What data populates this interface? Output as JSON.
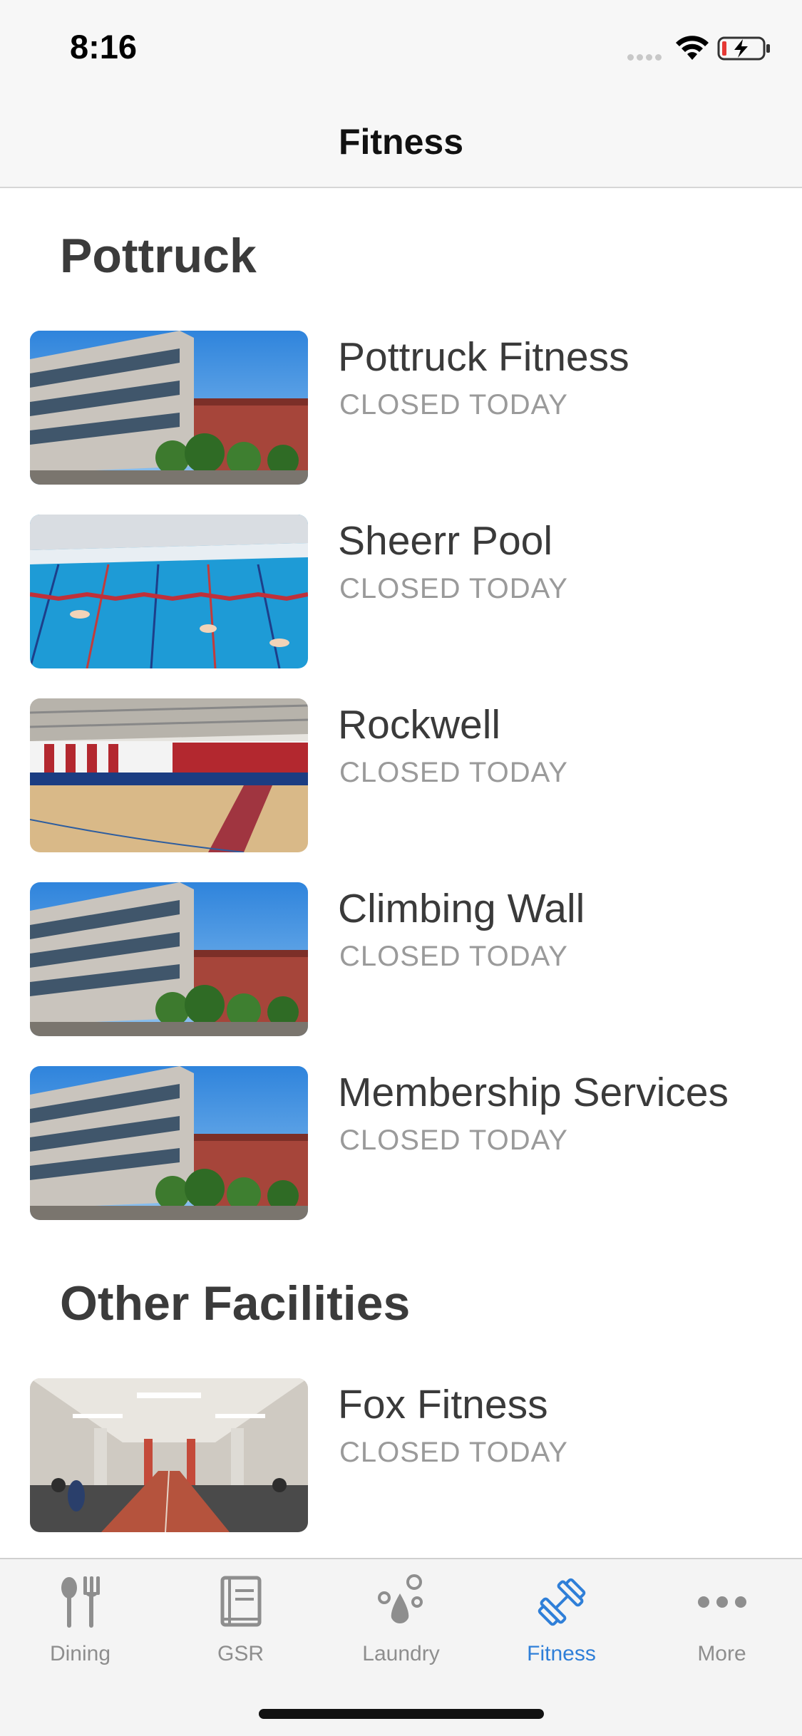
{
  "status_bar": {
    "time": "8:16"
  },
  "nav": {
    "title": "Fitness"
  },
  "sections": [
    {
      "title": "Pottruck",
      "items": [
        {
          "name": "Pottruck Fitness",
          "status": "CLOSED TODAY",
          "image": "building"
        },
        {
          "name": "Sheerr Pool",
          "status": "CLOSED TODAY",
          "image": "pool"
        },
        {
          "name": "Rockwell",
          "status": "CLOSED TODAY",
          "image": "gym"
        },
        {
          "name": "Climbing Wall",
          "status": "CLOSED TODAY",
          "image": "building"
        },
        {
          "name": "Membership Services",
          "status": "CLOSED TODAY",
          "image": "building"
        }
      ]
    },
    {
      "title": "Other Facilities",
      "items": [
        {
          "name": "Fox Fitness",
          "status": "CLOSED TODAY",
          "image": "fitness-room"
        }
      ]
    }
  ],
  "tabs": [
    {
      "label": "Dining",
      "icon": "fork-spoon-icon"
    },
    {
      "label": "GSR",
      "icon": "book-icon"
    },
    {
      "label": "Laundry",
      "icon": "drops-icon"
    },
    {
      "label": "Fitness",
      "icon": "dumbbell-icon",
      "active": true
    },
    {
      "label": "More",
      "icon": "ellipsis-icon"
    }
  ],
  "colors": {
    "accent": "#2f7fd8",
    "inactive": "#8e8e8e"
  }
}
